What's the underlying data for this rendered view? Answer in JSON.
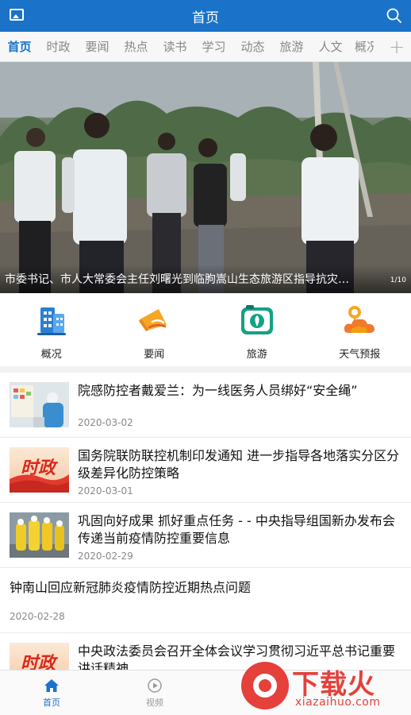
{
  "header": {
    "title": "首页",
    "left_icon": "image-icon",
    "right_icon": "search-icon"
  },
  "tabs": {
    "items": [
      "首页",
      "时政",
      "要闻",
      "热点",
      "读书",
      "学习",
      "动态",
      "旅游",
      "人文",
      "概况"
    ],
    "active": "首页",
    "more_icon": "plus-icon"
  },
  "banner": {
    "caption": "市委书记、市人大常委会主任刘曙光到临朐嵩山生态旅游区指导抗灾…",
    "pager": "1/10"
  },
  "quick_links": [
    {
      "label": "概况",
      "icon": "building-icon",
      "color": "#2a7fd4"
    },
    {
      "label": "要闻",
      "icon": "megaphone-icon",
      "color": "#f5a623"
    },
    {
      "label": "旅游",
      "icon": "camera-icon",
      "color": "#16a085"
    },
    {
      "label": "天气预报",
      "icon": "weather-cloud-icon",
      "color": "#f39c12"
    }
  ],
  "news": [
    {
      "title": "院感防控者戴爱兰：为一线医务人员绑好“安全绳”",
      "date": "2020-03-02",
      "thumb": "photo"
    },
    {
      "title": "国务院联防联控机制印发通知 进一步指导各地落实分区分级差异化防控策略",
      "date": "2020-03-01",
      "thumb": "shizheng",
      "thumb_text": "时政"
    },
    {
      "title": "巩固向好成果 抓好重点任务 - - 中央指导组国新办发布会传递当前疫情防控重要信息",
      "date": "2020-02-29",
      "thumb": "photo2"
    },
    {
      "title": "钟南山回应新冠肺炎疫情防控近期热点问题",
      "date": "2020-02-28",
      "thumb": "none"
    },
    {
      "title": "中央政法委员会召开全体会议学习贯彻习近平总书记重要讲话精神",
      "date": "",
      "thumb": "shizheng",
      "thumb_text": "时政"
    }
  ],
  "bottom_nav": [
    {
      "label": "首页",
      "icon": "home-icon",
      "active": true
    },
    {
      "label": "视频",
      "icon": "play-circle-icon",
      "active": false
    }
  ],
  "watermark": {
    "text": "下载火",
    "url": "xiazaihuo.com"
  },
  "colors": {
    "primary": "#1a73c9",
    "watermark": "#e5403a"
  }
}
